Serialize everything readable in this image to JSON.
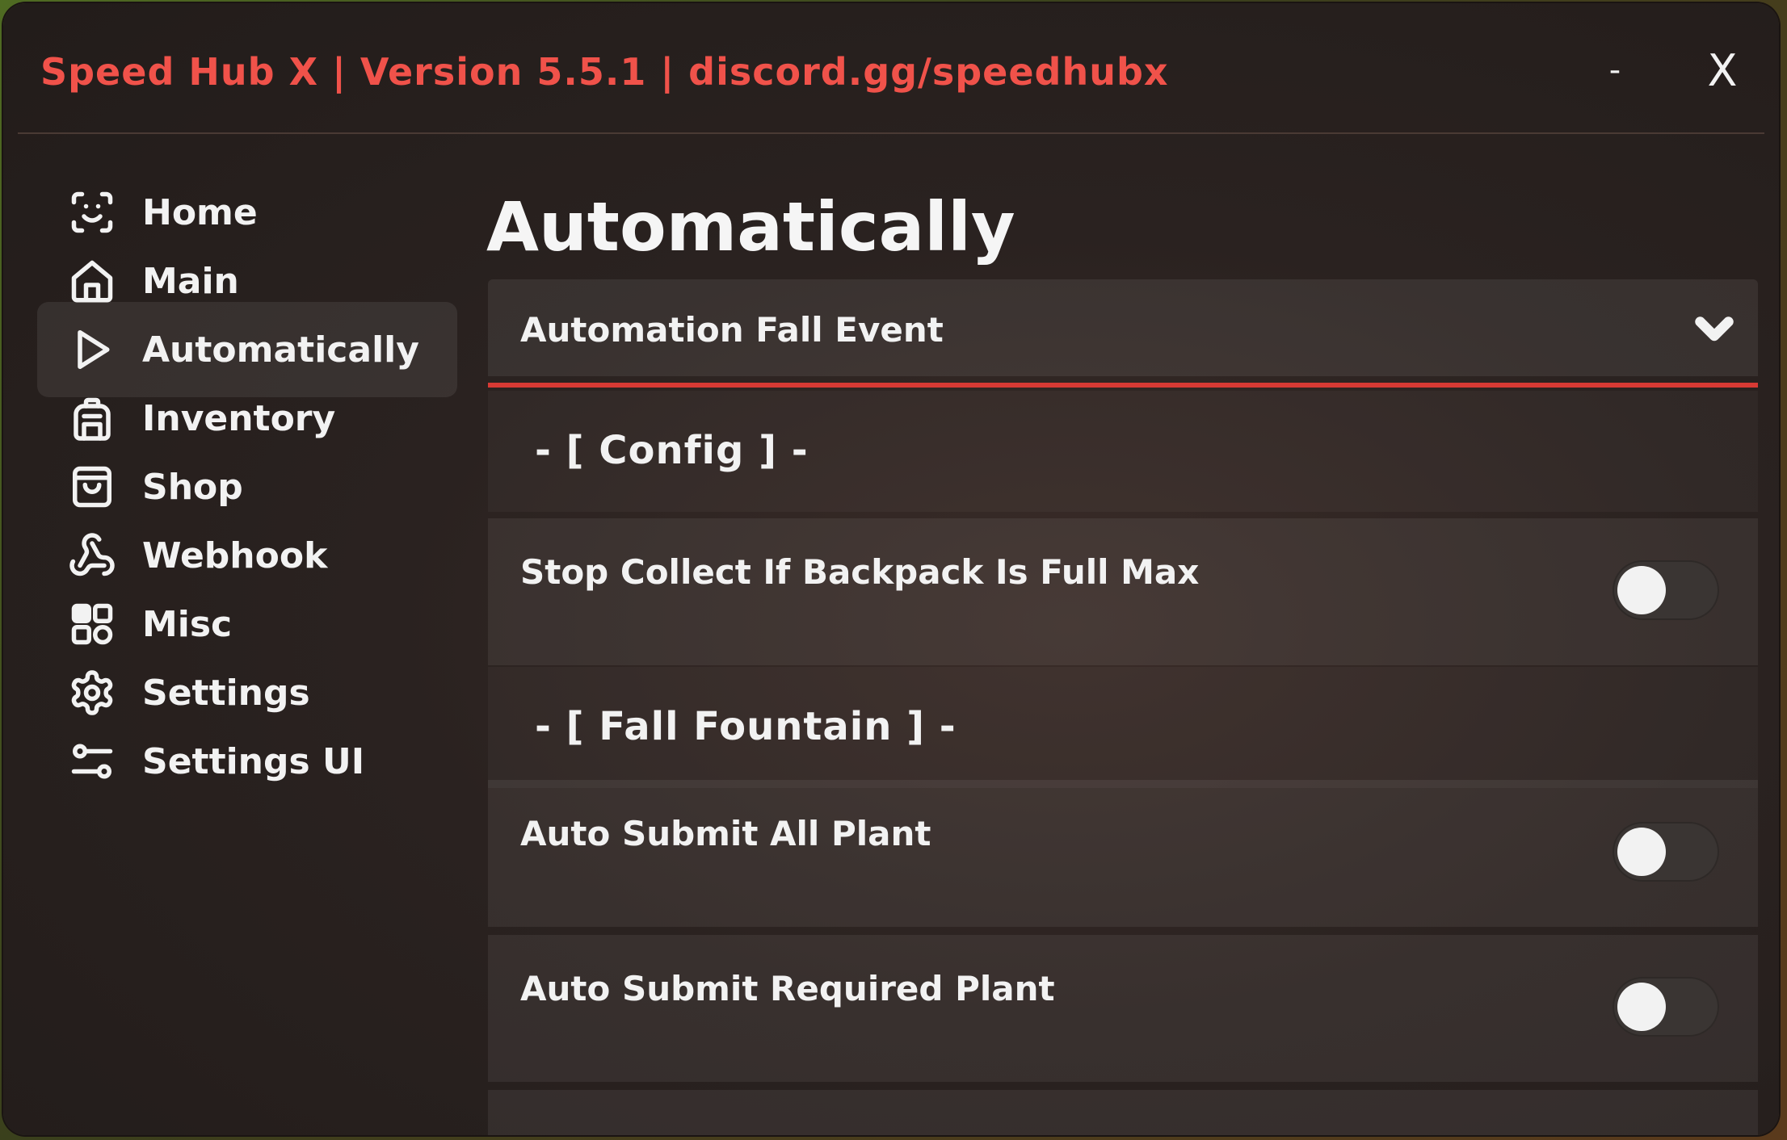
{
  "window": {
    "title": "Speed Hub X | Version 5.5.1 | discord.gg/speedhubx",
    "minimize_label": "-",
    "close_label": "X",
    "accent_color": "#d73a34"
  },
  "sidebar": {
    "items": [
      {
        "label": "Home",
        "icon": "face-scan-icon",
        "active": false
      },
      {
        "label": "Main",
        "icon": "home-icon",
        "active": false
      },
      {
        "label": "Automatically",
        "icon": "play-icon",
        "active": true
      },
      {
        "label": "Inventory",
        "icon": "backpack-icon",
        "active": false
      },
      {
        "label": "Shop",
        "icon": "shopping-bag-icon",
        "active": false
      },
      {
        "label": "Webhook",
        "icon": "webhook-icon",
        "active": false
      },
      {
        "label": "Misc",
        "icon": "grid-icon",
        "active": false
      },
      {
        "label": "Settings",
        "icon": "gear-icon",
        "active": false
      },
      {
        "label": "Settings UI",
        "icon": "sliders-icon",
        "active": false
      }
    ]
  },
  "main": {
    "page_title": "Automatically",
    "dropdown": {
      "label": "Automation Fall Event",
      "expanded": true
    },
    "sections": [
      {
        "label": "- [ Config ] -"
      },
      {
        "label": "- [ Fall Fountain ] -"
      }
    ],
    "toggles": [
      {
        "label": "Stop Collect If Backpack Is Full Max",
        "on": false
      },
      {
        "label": "Auto Submit All Plant",
        "on": false
      },
      {
        "label": "Auto Submit Required Plant",
        "on": false
      }
    ]
  }
}
